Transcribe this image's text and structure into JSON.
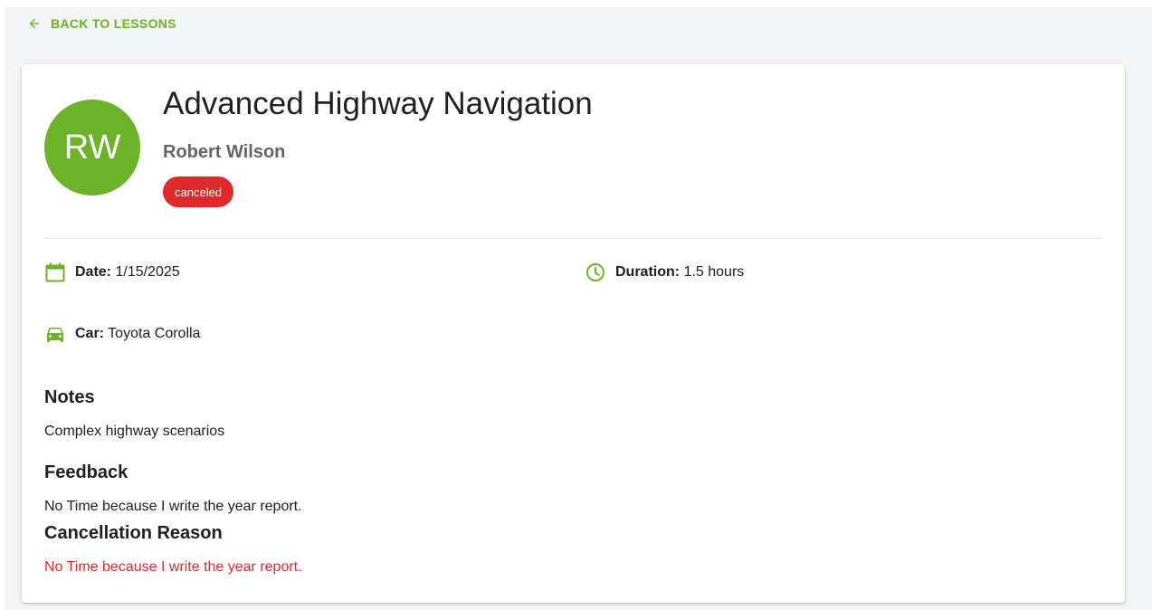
{
  "nav": {
    "back_label": "BACK TO LESSONS",
    "back_icon": "arrow-left-icon"
  },
  "lesson": {
    "avatar_initials": "RW",
    "title": "Advanced Highway Navigation",
    "instructor": "Robert Wilson",
    "status": "canceled",
    "date_label": "Date:",
    "date_value": "1/15/2025",
    "duration_label": "Duration:",
    "duration_value": "1.5 hours",
    "car_label": "Car:",
    "car_value": "Toyota Corolla"
  },
  "sections": {
    "notes_heading": "Notes",
    "notes_text": "Complex highway scenarios",
    "feedback_heading": "Feedback",
    "feedback_text": "No Time because I write the year report.",
    "cancellation_heading": "Cancellation Reason",
    "cancellation_text": "No Time because I write the year report."
  },
  "icons": {
    "date": "calendar-icon",
    "duration": "clock-icon",
    "car": "car-icon"
  },
  "colors": {
    "accent": "#6cb32a",
    "status_canceled": "#de2a2a",
    "cancellation_text": "#d32f2f",
    "background": "#f3f4f6"
  }
}
